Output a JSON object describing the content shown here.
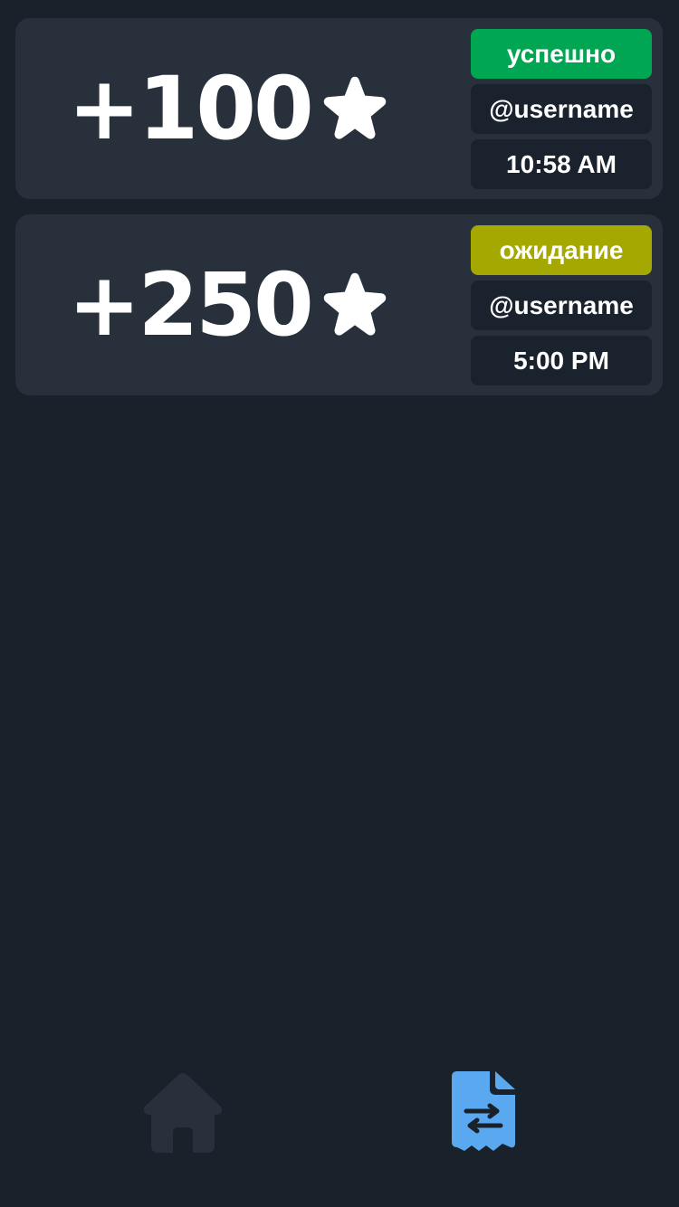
{
  "transactions": [
    {
      "amount": "+100",
      "status": "успешно",
      "status_color": "#00a651",
      "username": "@username",
      "time": "10:58 AM",
      "icon": "star-icon"
    },
    {
      "amount": "+250",
      "status": "ожидание",
      "status_color": "#a5a800",
      "username": "@username",
      "time": "5:00 PM",
      "icon": "star-icon"
    }
  ],
  "nav": {
    "items": [
      {
        "icon": "home-icon",
        "active": false,
        "color": "#28303c"
      },
      {
        "icon": "transactions-receipt-icon",
        "active": true,
        "color": "#5aa9f0"
      }
    ]
  },
  "colors": {
    "background": "#19212b",
    "card": "#28303c",
    "pill": "#1a222d"
  }
}
